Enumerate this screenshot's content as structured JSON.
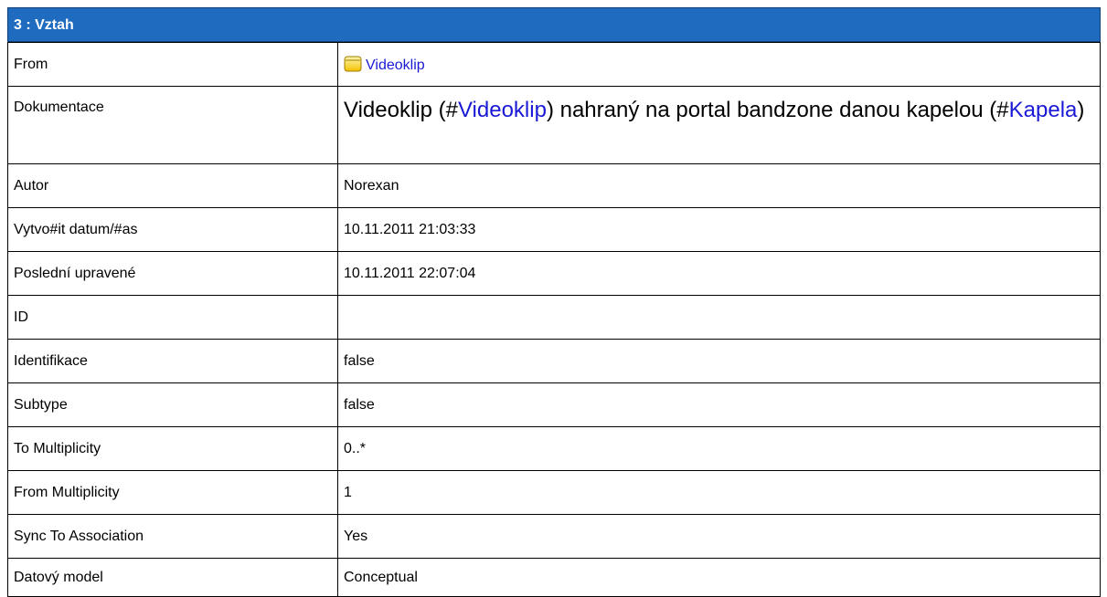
{
  "header": {
    "title": "3 : Vztah"
  },
  "rows": {
    "from": {
      "label": "From",
      "value": "Videoklip"
    },
    "doc": {
      "label": "Dokumentace",
      "parts": [
        "Videoklip (#",
        "Videoklip",
        ") nahraný na portal bandzone danou kapelou (#",
        "Kapela",
        ")"
      ]
    },
    "autor": {
      "label": "Autor",
      "value": "Norexan"
    },
    "created": {
      "label": "Vytvo#it datum/#as",
      "value": "10.11.2011 21:03:33"
    },
    "modified": {
      "label": "Poslední upravené",
      "value": "10.11.2011 22:07:04"
    },
    "id": {
      "label": "ID",
      "value": ""
    },
    "identifikace": {
      "label": "Identifikace",
      "value": "false"
    },
    "subtype": {
      "label": "Subtype",
      "value": "false"
    },
    "to_mult": {
      "label": "To Multiplicity",
      "value": "0..*"
    },
    "from_mult": {
      "label": "From Multiplicity",
      "value": "1"
    },
    "sync": {
      "label": "Sync To Association",
      "value": "Yes"
    },
    "datovy": {
      "label": "Datový model",
      "value": "Conceptual"
    }
  },
  "icons": {
    "from_icon": "entity-icon"
  },
  "colors": {
    "header_bg": "#1e6bbf",
    "link": "#1a1ad6"
  }
}
